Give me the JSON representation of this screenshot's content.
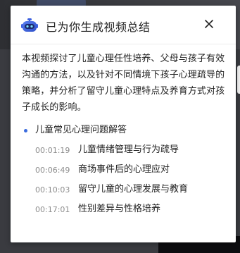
{
  "dialog": {
    "title": "已为你生成视频总结",
    "close_icon": "close-icon",
    "bot_icon": "robot-icon",
    "accent_color": "#3a6bde"
  },
  "summary": {
    "text": "本视频探讨了儿童心理任性培养、父母与孩子有效沟通的方法，以及针对不同情境下孩子心理疏导的策略，并分析了留守儿童心理特点及养育方式对孩子成长的影响。"
  },
  "section": {
    "title": "儿童常见心理问题解答",
    "items": [
      {
        "time": "00:01:19",
        "label": "儿童情绪管理与行为疏导"
      },
      {
        "time": "00:06:49",
        "label": "商场事件后的心理应对"
      },
      {
        "time": "00:10:03",
        "label": "留守儿童的心理发展与教育"
      },
      {
        "time": "00:17:01",
        "label": "性别差异与性格培养"
      }
    ]
  }
}
